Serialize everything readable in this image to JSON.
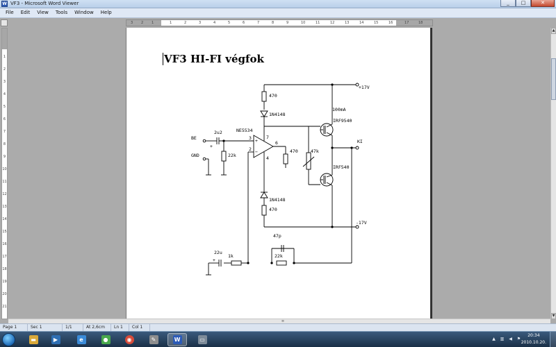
{
  "window": {
    "title": "VF3 - Microsoft Word Viewer",
    "app_icon": "word-viewer-icon",
    "controls": [
      "minimize",
      "maximize",
      "close"
    ]
  },
  "menu": {
    "file": "File",
    "edit": "Edit",
    "view": "View",
    "tools": "Tools",
    "window": "Window",
    "help": "Help"
  },
  "ruler": {
    "h_left_numbers": [
      "3",
      "2",
      "1"
    ],
    "h_numbers": [
      "1",
      "2",
      "3",
      "4",
      "5",
      "6",
      "7",
      "8",
      "9",
      "10",
      "11",
      "12",
      "13",
      "14",
      "15",
      "16"
    ],
    "h_right_numbers": [
      "17",
      "18"
    ],
    "v_numbers": [
      "1",
      "2",
      "3",
      "4",
      "5",
      "6",
      "7",
      "8",
      "9",
      "10",
      "11",
      "12",
      "13",
      "14",
      "15",
      "16",
      "17",
      "18",
      "19",
      "20",
      "21"
    ]
  },
  "document": {
    "heading": "VF3 HI-FI végfok",
    "schematic": {
      "labels": {
        "r_top": "470",
        "supply_pos": "+17V",
        "diode_top": "1N4148",
        "current": "100mA",
        "opamp": "NE5534",
        "mosfet_p": "IRF9540",
        "input": "BE",
        "cap_in": "2u2",
        "pin3": "3",
        "pin7": "7",
        "pin6": "6",
        "pin2": "2",
        "pin4": "4",
        "output": "KI",
        "plus": "+",
        "minus": "−",
        "gnd": "GND",
        "r_in": "22k",
        "r_mid": "470",
        "pot": "47k",
        "mosfet_n": "IRF540",
        "diode_bottom": "1N4148",
        "r_bottom": "470",
        "supply_neg": "-17V",
        "cap_fb": "47p",
        "cap_gnd": "22u",
        "r_1k": "1k",
        "r_fb": "22k"
      }
    }
  },
  "status": {
    "page": "Page  1",
    "sec": "Sec  1",
    "pages": "1/1",
    "at": "At  2,6cm",
    "ln": "Ln  1",
    "col": "Col  1"
  },
  "taskbar": {
    "apps": [
      "explorer-icon",
      "media-player-icon",
      "internet-explorer-icon",
      "messenger-icon",
      "chrome-icon",
      "paint-icon",
      "word-viewer-icon",
      "network-drive-icon"
    ],
    "clock_time": "20:34",
    "clock_date": "2010.10.20."
  }
}
